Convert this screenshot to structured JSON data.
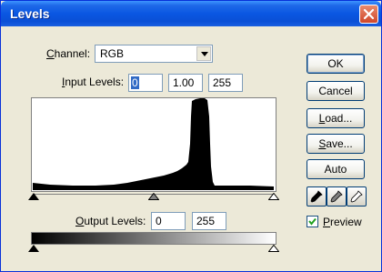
{
  "window": {
    "title": "Levels"
  },
  "channel": {
    "label_pre": "C",
    "label_rest": "hannel:",
    "value": "RGB"
  },
  "input_levels": {
    "label_pre": "I",
    "label_rest": "nput Levels:",
    "black": "0",
    "gamma": "1.00",
    "white": "255"
  },
  "output_levels": {
    "label_pre": "O",
    "label_rest": "utput Levels:",
    "black": "0",
    "white": "255"
  },
  "buttons": {
    "ok": "OK",
    "cancel": "Cancel",
    "load_pre": "L",
    "load_rest": "oad...",
    "save_pre": "S",
    "save_rest": "ave...",
    "auto": "Auto"
  },
  "preview": {
    "label_pre": "P",
    "label_rest": "review",
    "checked": true
  },
  "colors": {
    "titlebar": "#0A57E2",
    "selection": "#316AC5",
    "close": "#D0472A"
  },
  "icons": [
    "close-icon",
    "chevron-down-icon",
    "black-eyedropper-icon",
    "gray-eyedropper-icon",
    "white-eyedropper-icon",
    "checkmark-icon"
  ]
}
